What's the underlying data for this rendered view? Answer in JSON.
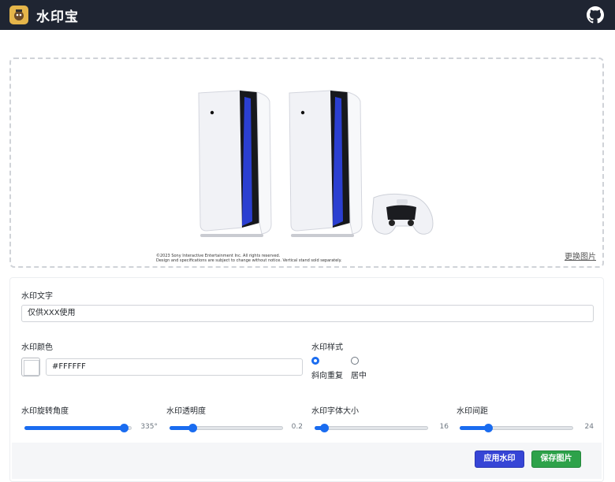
{
  "app": {
    "title": "水印宝"
  },
  "preview": {
    "change_image_label": "更换图片",
    "caption_line1": "©2023 Sony Interactive Entertainment Inc. All rights reserved.",
    "caption_line2": "Design and specifications are subject to change without notice. Vertical stand sold separately."
  },
  "form": {
    "text_label": "水印文字",
    "text_value": "仅供XXX使用",
    "color_label": "水印颜色",
    "color_value": "#FFFFFF",
    "style_label": "水印样式",
    "style_options": [
      "斜向重复",
      "居中"
    ],
    "style_selected": "斜向重复",
    "sliders": [
      {
        "label": "水印旋转角度",
        "value": 335,
        "display": "335°",
        "fraction": 0.93
      },
      {
        "label": "水印透明度",
        "value": 0.2,
        "display": "0.2",
        "fraction": 0.2
      },
      {
        "label": "水印字体大小",
        "value": 16,
        "display": "16",
        "fraction": 0.08
      },
      {
        "label": "水印间距",
        "value": 24,
        "display": "24",
        "fraction": 0.25
      }
    ],
    "apply_button": "应用水印",
    "save_button": "保存图片"
  },
  "colors": {
    "accent": "#1a6cf0",
    "topbar": "#1f2532",
    "apply": "#3645d6",
    "save": "#2ea24a"
  }
}
